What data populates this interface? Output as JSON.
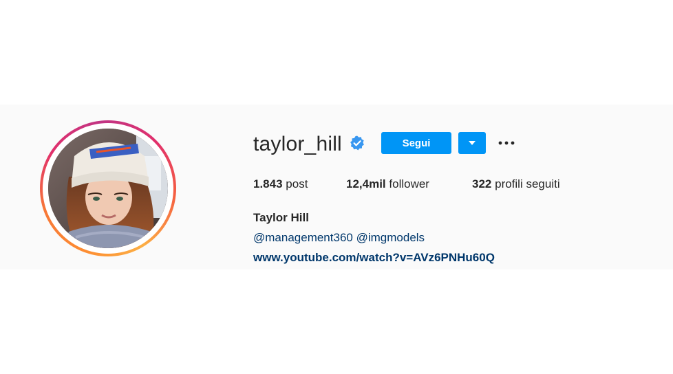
{
  "profile": {
    "username": "taylor_hill",
    "verified": true,
    "full_name": "Taylor Hill",
    "bio_mentions": [
      "@management360",
      "@imgmodels"
    ],
    "bio_link": "www.youtube.com/watch?v=AVz6PNHu60Q"
  },
  "actions": {
    "follow_label": "Segui",
    "dropdown_icon": "triangle-down-icon",
    "more_icon": "ellipsis-icon"
  },
  "stats": {
    "posts_count": "1.843",
    "posts_label": "post",
    "followers_count": "12,4mil",
    "followers_label": "follower",
    "following_count": "322",
    "following_label": "profili seguiti"
  },
  "colors": {
    "primary_button": "#0095f6",
    "link": "#00376b",
    "text": "#262626",
    "verified_badge": "#3897f0"
  }
}
